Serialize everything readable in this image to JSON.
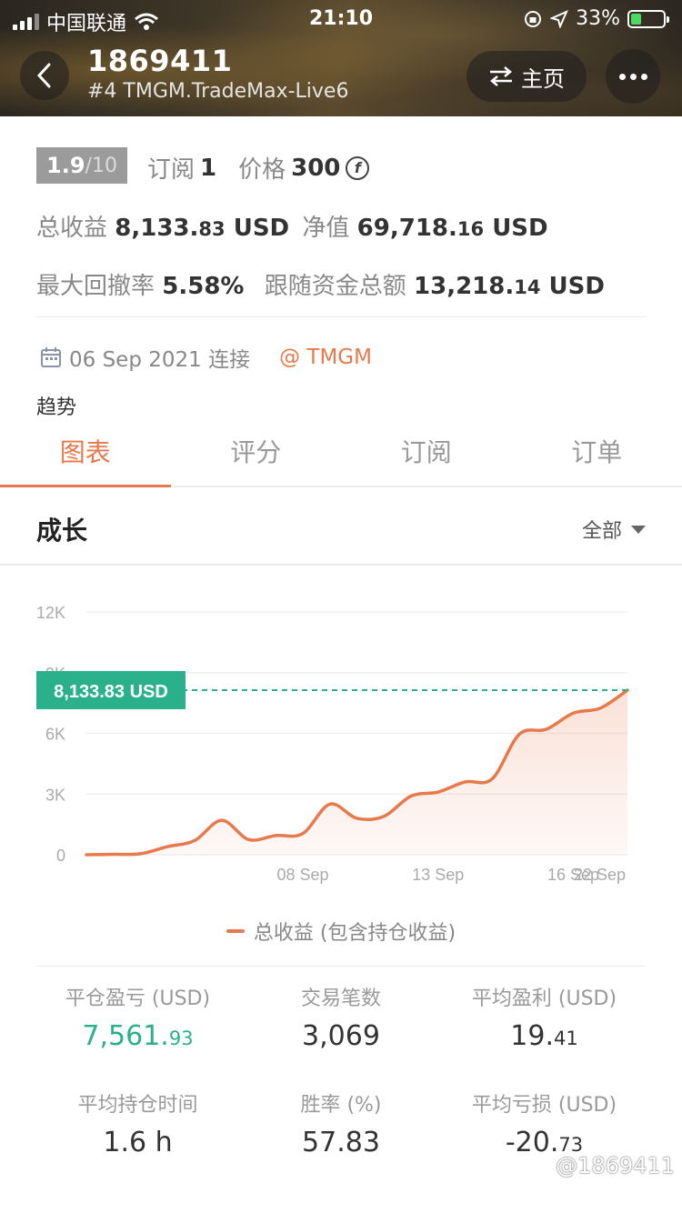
{
  "status_bar": {
    "carrier": "中国联通",
    "time": "21:10",
    "battery": "33%",
    "battery_level": 0.33
  },
  "header": {
    "account_id": "1869411",
    "server": "#4 TMGM.TradeMax-Live6",
    "home_label": "主页"
  },
  "info": {
    "rating": "1.9",
    "rating_max": "/10",
    "subscribe_label": "订阅",
    "subscribe_count": "1",
    "price_label": "价格",
    "price_value": "300",
    "coin_symbol": "f",
    "total_profit_label": "总收益",
    "total_profit_int": "8,133.",
    "total_profit_dec": "83",
    "total_profit_unit": "USD",
    "equity_label": "净值",
    "equity_int": "69,718.",
    "equity_dec": "16",
    "equity_unit": "USD",
    "max_drawdown_label": "最大回撤率",
    "max_drawdown_value": "5.58%",
    "follow_label": "跟随资金总额",
    "follow_int": "13,218.",
    "follow_dec": "14",
    "follow_unit": "USD",
    "connect_date": "06 Sep 2021 连接",
    "broker": "@ TMGM",
    "trend_label": "趋势"
  },
  "tabs": [
    {
      "label": "图表",
      "active": true
    },
    {
      "label": "评分"
    },
    {
      "label": "订阅"
    },
    {
      "label": "订单"
    }
  ],
  "growth": {
    "title": "成长",
    "range": "全部"
  },
  "accent_color": "#e8794c",
  "green_color": "#2ab08b",
  "chart_data": {
    "type": "area",
    "y_ticks": [
      "12K",
      "9K",
      "6K",
      "3K",
      "0"
    ],
    "y_tick_values": [
      12000,
      9000,
      6000,
      3000,
      0
    ],
    "ylim": [
      0,
      12000
    ],
    "x_ticks": [
      "08 Sep",
      "13 Sep",
      "16 Sep",
      "22 Sep"
    ],
    "x_tick_index": [
      8,
      13,
      18,
      22
    ],
    "current_label": "8,133.83 USD",
    "current_value": 8133.83,
    "series": [
      {
        "name": "总收益 (包含持仓收益)",
        "color": "#e8794c",
        "values": [
          0,
          20,
          50,
          400,
          700,
          1700,
          750,
          950,
          1050,
          2500,
          1800,
          1900,
          2900,
          3100,
          3600,
          3750,
          5950,
          6200,
          7000,
          7250,
          8133.83
        ]
      }
    ],
    "legend_label": "总收益 (包含持仓收益)",
    "grid": true
  },
  "stats": [
    {
      "label": "平仓盈亏 (USD)",
      "int": "7,561.",
      "dec": "93",
      "green": true
    },
    {
      "label": "交易笔数",
      "int": "3,069",
      "dec": ""
    },
    {
      "label": "平均盈利 (USD)",
      "int": "19.",
      "dec": "41"
    },
    {
      "label": "平均持仓时间",
      "int": "1.6 h",
      "dec": ""
    },
    {
      "label": "胜率 (%)",
      "int": "57.83",
      "dec": ""
    },
    {
      "label": "平均亏损 (USD)",
      "int": "-20.",
      "dec": "73"
    }
  ],
  "watermark": "@1869411"
}
